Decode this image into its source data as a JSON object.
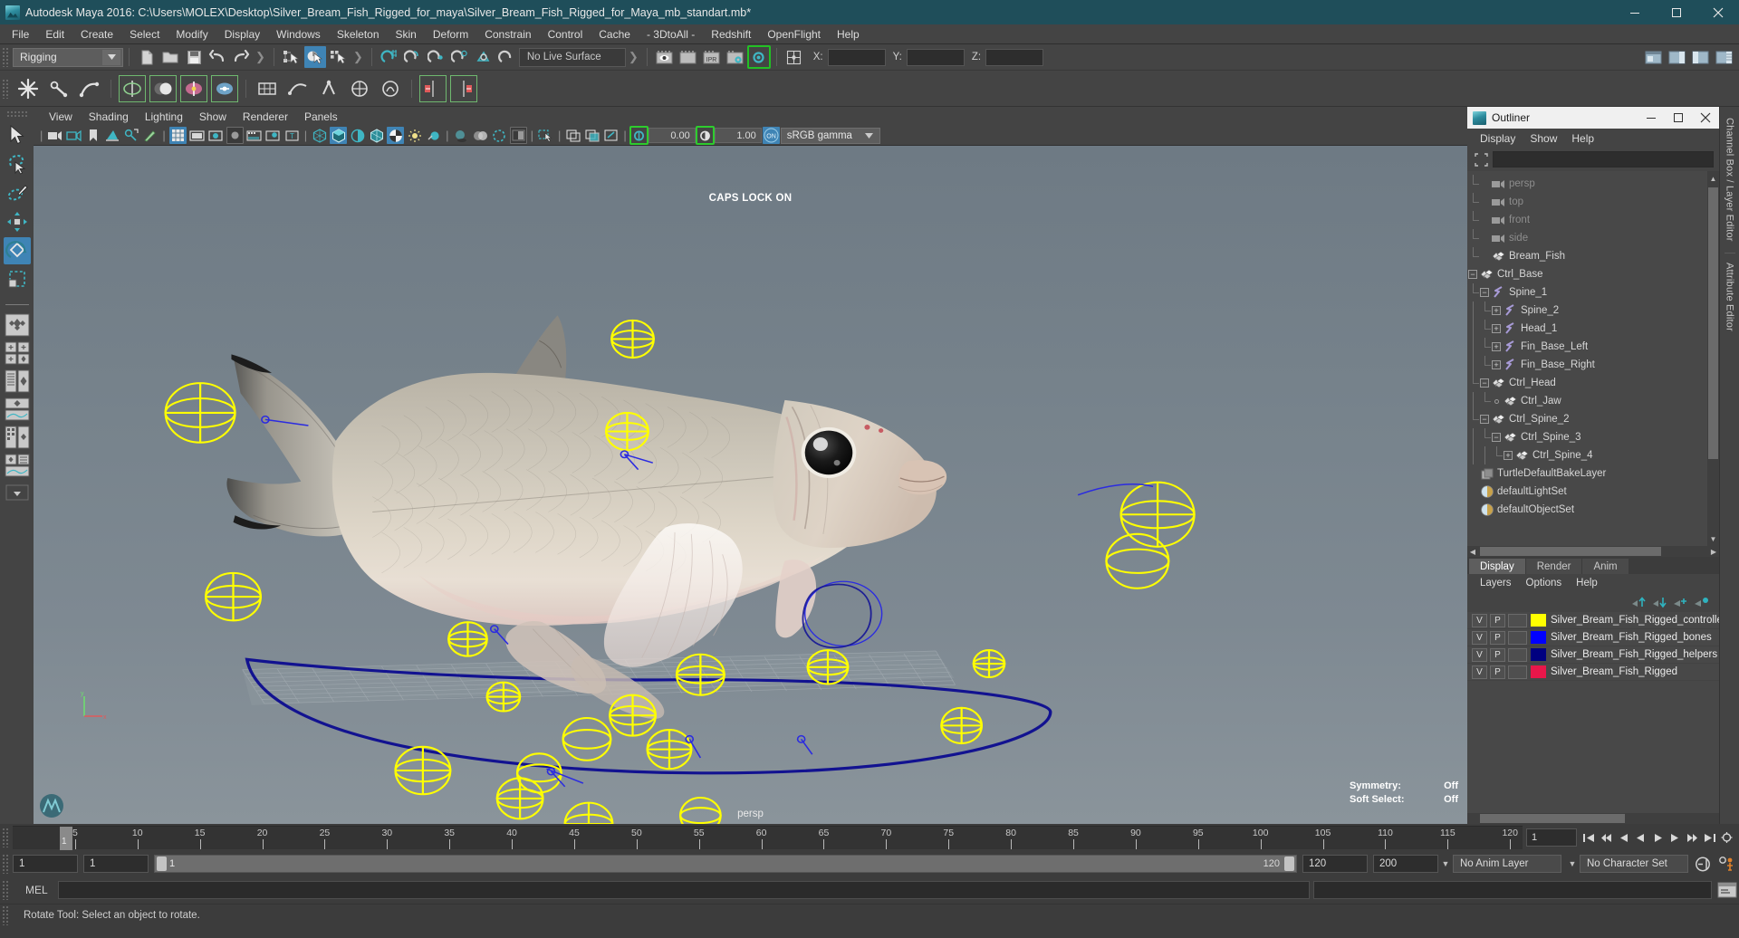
{
  "window": {
    "title": "Autodesk Maya 2016: C:\\Users\\MOLEX\\Desktop\\Silver_Bream_Fish_Rigged_for_maya\\Silver_Bream_Fish_Rigged_for_Maya_mb_standart.mb*",
    "minimize_label": "─",
    "maximize_label": "□",
    "close_label": "✕"
  },
  "menubar": {
    "items": [
      "File",
      "Edit",
      "Create",
      "Select",
      "Modify",
      "Display",
      "Windows",
      "Skeleton",
      "Skin",
      "Deform",
      "Constrain",
      "Control",
      "Cache",
      "- 3DtoAll -",
      "Redshift",
      "OpenFlight",
      "Help"
    ]
  },
  "statusline": {
    "menuset": "Rigging",
    "live_surface": "No Live Surface",
    "coord_labels": [
      "X:",
      "Y:",
      "Z:"
    ],
    "coord_values": [
      "",
      "",
      ""
    ]
  },
  "panel": {
    "menus": [
      "View",
      "Shading",
      "Lighting",
      "Show",
      "Renderer",
      "Panels"
    ],
    "exposure_value": "0.00",
    "gamma_value": "1.00",
    "color_space": "sRGB gamma",
    "camera_label": "persp",
    "caps_lock_notice": "CAPS LOCK ON",
    "symmetry_label": "Symmetry:",
    "symmetry_value": "Off",
    "soft_select_label": "Soft Select:",
    "soft_select_value": "Off",
    "axis_x": "x",
    "axis_y": "y"
  },
  "outliner": {
    "title": "Outliner",
    "menus": [
      "Display",
      "Show",
      "Help"
    ],
    "search_value": "",
    "search_placeholder": "",
    "tree": [
      {
        "label": "persp",
        "indent": 1,
        "icon": "camera-icon",
        "toggle": "none",
        "dim": true
      },
      {
        "label": "top",
        "indent": 1,
        "icon": "camera-icon",
        "toggle": "none",
        "dim": true
      },
      {
        "label": "front",
        "indent": 1,
        "icon": "camera-icon",
        "toggle": "none",
        "dim": true
      },
      {
        "label": "side",
        "indent": 1,
        "icon": "camera-icon",
        "toggle": "none",
        "dim": true
      },
      {
        "label": "Bream_Fish",
        "indent": 1,
        "icon": "transform-icon",
        "toggle": "none",
        "dim": false
      },
      {
        "label": "Ctrl_Base",
        "indent": 0,
        "icon": "transform-icon",
        "toggle": "minus",
        "dim": false
      },
      {
        "label": "Spine_1",
        "indent": 1,
        "icon": "joint-icon",
        "toggle": "minus",
        "dim": false
      },
      {
        "label": "Spine_2",
        "indent": 2,
        "icon": "joint-icon",
        "toggle": "plus",
        "dim": false
      },
      {
        "label": "Head_1",
        "indent": 2,
        "icon": "joint-icon",
        "toggle": "plus",
        "dim": false
      },
      {
        "label": "Fin_Base_Left",
        "indent": 2,
        "icon": "joint-icon",
        "toggle": "plus",
        "dim": false
      },
      {
        "label": "Fin_Base_Right",
        "indent": 2,
        "icon": "joint-icon",
        "toggle": "plus",
        "dim": false
      },
      {
        "label": "Ctrl_Head",
        "indent": 1,
        "icon": "transform-icon",
        "toggle": "minus",
        "dim": false
      },
      {
        "label": "Ctrl_Jaw",
        "indent": 2,
        "icon": "transform-icon",
        "toggle": "dot",
        "dim": false
      },
      {
        "label": "Ctrl_Spine_2",
        "indent": 1,
        "icon": "transform-icon",
        "toggle": "minus",
        "dim": false
      },
      {
        "label": "Ctrl_Spine_3",
        "indent": 2,
        "icon": "transform-icon",
        "toggle": "minus",
        "dim": false
      },
      {
        "label": "Ctrl_Spine_4",
        "indent": 3,
        "icon": "transform-icon",
        "toggle": "plus",
        "dim": false
      },
      {
        "label": "TurtleDefaultBakeLayer",
        "indent": 0,
        "icon": "bakelayer-icon",
        "toggle": "none",
        "dim": false
      },
      {
        "label": "defaultLightSet",
        "indent": 0,
        "icon": "set-icon",
        "toggle": "none",
        "dim": false
      },
      {
        "label": "defaultObjectSet",
        "indent": 0,
        "icon": "set-icon",
        "toggle": "none",
        "dim": false
      }
    ]
  },
  "layer_editor": {
    "tabs": [
      "Display",
      "Render",
      "Anim"
    ],
    "selected_tab": "Display",
    "menus": [
      "Layers",
      "Options",
      "Help"
    ],
    "col_visible": "V",
    "col_playback": "P",
    "layers": [
      {
        "name": "Silver_Bream_Fish_Rigged_controlle",
        "color": "#ffff00",
        "v": "V",
        "p": "P"
      },
      {
        "name": "Silver_Bream_Fish_Rigged_bones",
        "color": "#0000ff",
        "v": "V",
        "p": "P"
      },
      {
        "name": "Silver_Bream_Fish_Rigged_helpers",
        "color": "#000080",
        "v": "V",
        "p": "P"
      },
      {
        "name": "Silver_Bream_Fish_Rigged",
        "color": "#e8174a",
        "v": "V",
        "p": "P"
      }
    ]
  },
  "channelbox_strip": {
    "label_top": "Channel Box / Layer Editor",
    "label_bottom": "Attribute Editor"
  },
  "timeline": {
    "current_frame": "1",
    "ticks": [
      {
        "label": "5",
        "frame": 5
      },
      {
        "label": "10",
        "frame": 10
      },
      {
        "label": "15",
        "frame": 15
      },
      {
        "label": "20",
        "frame": 20
      },
      {
        "label": "25",
        "frame": 25
      },
      {
        "label": "30",
        "frame": 30
      },
      {
        "label": "35",
        "frame": 35
      },
      {
        "label": "40",
        "frame": 40
      },
      {
        "label": "45",
        "frame": 45
      },
      {
        "label": "50",
        "frame": 50
      },
      {
        "label": "55",
        "frame": 55
      },
      {
        "label": "60",
        "frame": 60
      },
      {
        "label": "65",
        "frame": 65
      },
      {
        "label": "70",
        "frame": 70
      },
      {
        "label": "75",
        "frame": 75
      },
      {
        "label": "80",
        "frame": 80
      },
      {
        "label": "85",
        "frame": 85
      },
      {
        "label": "90",
        "frame": 90
      },
      {
        "label": "95",
        "frame": 95
      },
      {
        "label": "100",
        "frame": 100
      },
      {
        "label": "105",
        "frame": 105
      },
      {
        "label": "110",
        "frame": 110
      },
      {
        "label": "115",
        "frame": 115
      },
      {
        "label": "120",
        "frame": 120
      }
    ],
    "frame_field": "1"
  },
  "range": {
    "start": "1",
    "anim_start": "1",
    "bar_start": "1",
    "bar_end": "120",
    "anim_end": "120",
    "end": "200",
    "anim_layer": "No Anim Layer",
    "character_set": "No Character Set"
  },
  "mel": {
    "label": "MEL",
    "command_value": "",
    "output_value": ""
  },
  "helpline": {
    "text": "Rotate Tool: Select an object to rotate."
  },
  "colors": {
    "titlebar": "#1f4e5a",
    "accent_blue": "#3f84b5",
    "teal_icon": "#3fb6c4",
    "controller_yellow": "#ffff00",
    "curve_navy": "#141496"
  }
}
